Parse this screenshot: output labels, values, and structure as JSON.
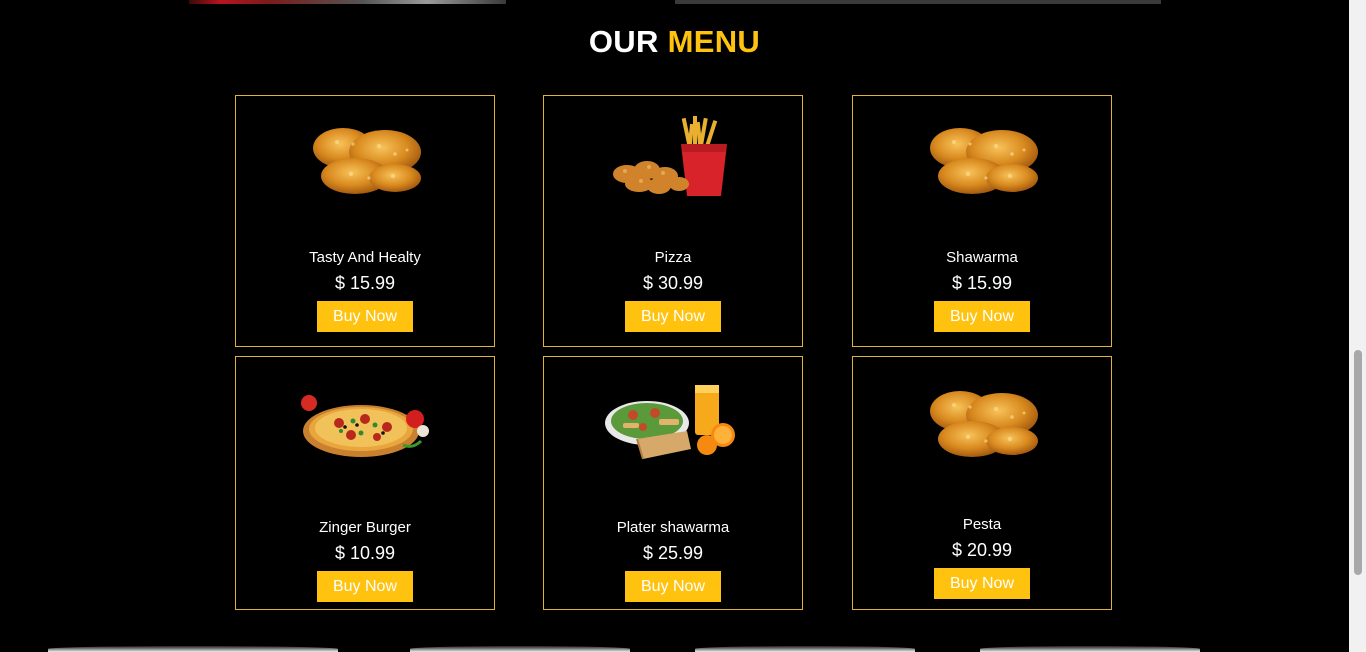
{
  "section": {
    "title_part1": "OUR",
    "title_part2": "MENU"
  },
  "menu_items": [
    {
      "name": "Tasty And Healty",
      "price": "$ 15.99",
      "button": "Buy Now",
      "image": "fried-chicken-image"
    },
    {
      "name": "Pizza",
      "price": "$ 30.99",
      "button": "Buy Now",
      "image": "nuggets-fries-image"
    },
    {
      "name": "Shawarma",
      "price": "$ 15.99",
      "button": "Buy Now",
      "image": "fried-chicken-image"
    },
    {
      "name": "Zinger Burger",
      "price": "$ 10.99",
      "button": "Buy Now",
      "image": "pizza-image"
    },
    {
      "name": "Plater shawarma",
      "price": "$ 25.99",
      "button": "Buy Now",
      "image": "shawarma-platter-image"
    },
    {
      "name": "Pesta",
      "price": "$ 20.99",
      "button": "Buy Now",
      "image": "fried-chicken-image"
    }
  ],
  "colors": {
    "background": "#000000",
    "accent": "#ffc20e",
    "card_border": "#e0b23a",
    "text": "#ffffff"
  }
}
